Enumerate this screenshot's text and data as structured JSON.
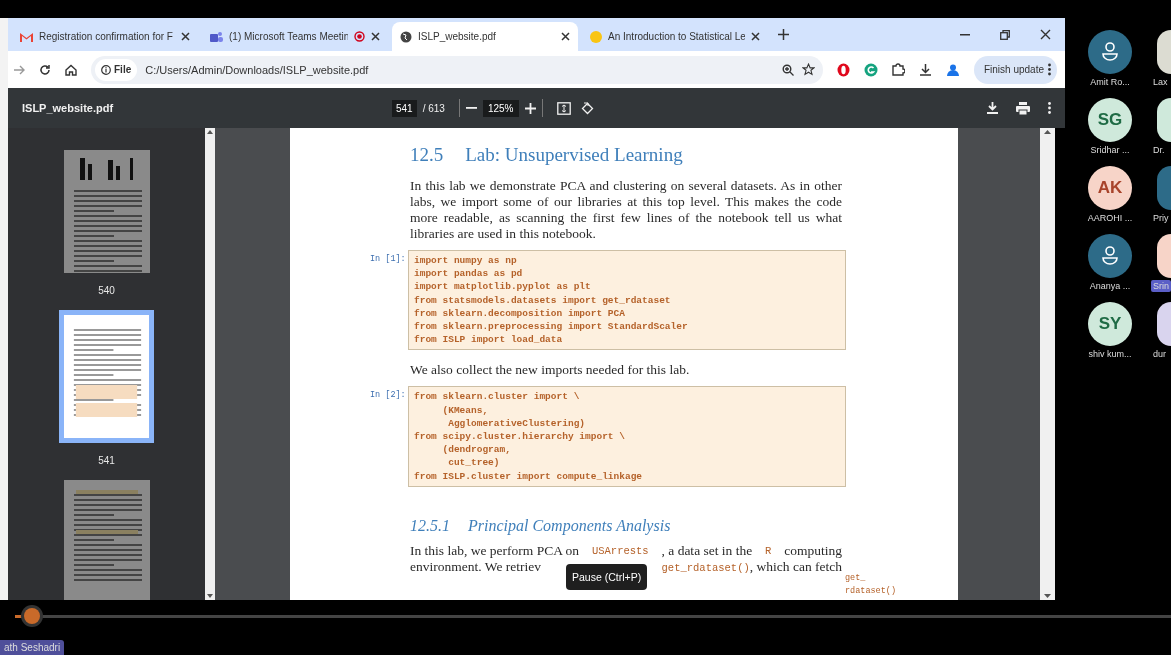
{
  "tabs": [
    {
      "label": "Registration confirmation for F",
      "kind": "mail",
      "selected": false,
      "recording": false
    },
    {
      "label": "(1) Microsoft Teams Meetin",
      "kind": "teams",
      "selected": false,
      "recording": true
    },
    {
      "label": "ISLP_website.pdf",
      "kind": "globe",
      "selected": true,
      "recording": false
    },
    {
      "label": "An Introduction to Statistical Le",
      "kind": "dot",
      "selected": false,
      "recording": false
    }
  ],
  "address_bar": {
    "scheme": "File",
    "url": "C:/Users/Admin/Downloads/ISLP_website.pdf",
    "update_button": "Finish update"
  },
  "pdf_toolbar": {
    "title": "ISLP_website.pdf",
    "page": "541",
    "page_count": "/ 613",
    "zoom": "125%"
  },
  "thumbnails": [
    {
      "label": "540",
      "selected": false
    },
    {
      "label": "541",
      "selected": true
    },
    {
      "selected": false
    }
  ],
  "page": {
    "blocks": [
      {
        "kind": "heading",
        "number": "12.5",
        "text": "Lab: Unsupervised Learning"
      },
      {
        "kind": "paragraph",
        "parts": [
          {
            "kind": "text",
            "text": "In this lab we demonstrate PCA and clustering on several datasets. As in other labs, we import some of our libraries at this top level. This makes the code more readable, as scanning the first few lines of the notebook tell us what libraries are used in this notebook."
          }
        ]
      },
      {
        "kind": "code",
        "prompt": "In [1]:",
        "lines": [
          "import numpy as np",
          "import pandas as pd",
          "import matplotlib.pyplot as plt",
          "from statsmodels.datasets import get_rdataset",
          "from sklearn.decomposition import PCA",
          "from sklearn.preprocessing import StandardScaler",
          "from ISLP import load_data"
        ]
      },
      {
        "kind": "paragraph",
        "parts": [
          {
            "kind": "text",
            "text": "We also collect the new imports needed for this lab."
          }
        ]
      },
      {
        "kind": "code",
        "prompt": "In [2]:",
        "lines": [
          "from sklearn.cluster import \\",
          "     (KMeans,",
          "      AgglomerativeClustering)",
          "from scipy.cluster.hierarchy import \\",
          "     (dendrogram,",
          "      cut_tree)",
          "from ISLP.cluster import compute_linkage"
        ]
      },
      {
        "kind": "subheading",
        "number": "12.5.1",
        "text": "Principal Components Analysis"
      },
      {
        "kind": "line",
        "parts": [
          {
            "kind": "text",
            "text": "In this lab, we perform PCA on "
          },
          {
            "kind": "code",
            "text": "USArrests"
          },
          {
            "kind": "text",
            "text": ", a data set in the "
          },
          {
            "kind": "code",
            "text": "R"
          },
          {
            "kind": "text",
            "text": " computing"
          }
        ]
      },
      {
        "kind": "split_line",
        "segments": [
          [
            {
              "kind": "text",
              "text": "environment. We retriev"
            }
          ],
          [
            {
              "kind": "code",
              "text": "get_rdataset()"
            },
            {
              "kind": "text",
              "text": ", which can fetch"
            }
          ]
        ],
        "margin_note": "get_ rdataset()"
      }
    ]
  },
  "tooltip": "Pause (Ctrl+P)",
  "participants": [
    {
      "kind": "placeholder",
      "name": "Amit Ro...",
      "color": "#2d6b88",
      "speaking": false
    },
    {
      "kind": "placeholder",
      "name": "Lax",
      "color": "#dcdcd2",
      "speaking": false
    },
    {
      "kind": "initials",
      "initials": "SG",
      "name": "Sridhar ...",
      "color": "#cfe9db",
      "speaking": false
    },
    {
      "kind": "placeholder",
      "name": "Dr.",
      "color": "#cfe9db",
      "speaking": false
    },
    {
      "kind": "initials",
      "initials": "AK",
      "name": "AAROHI ...",
      "color": "#f7d4c8",
      "speaking": false
    },
    {
      "kind": "placeholder",
      "name": "Priy",
      "color": "#2d6b88",
      "speaking": false
    },
    {
      "kind": "placeholder",
      "name": "Ananya ...",
      "color": "#2d6b88",
      "speaking": false
    },
    {
      "kind": "placeholder",
      "name": "Srin",
      "color": "#f7d4c8",
      "speaking": true
    },
    {
      "kind": "initials",
      "initials": "SY",
      "name": "shiv kum...",
      "color": "#cfe9db",
      "speaking": false
    },
    {
      "kind": "placeholder",
      "name": "dur",
      "color": "#d9d4ee",
      "speaking": false
    }
  ],
  "player": {
    "level": 0.015,
    "presenter": "ath Seshadri"
  }
}
